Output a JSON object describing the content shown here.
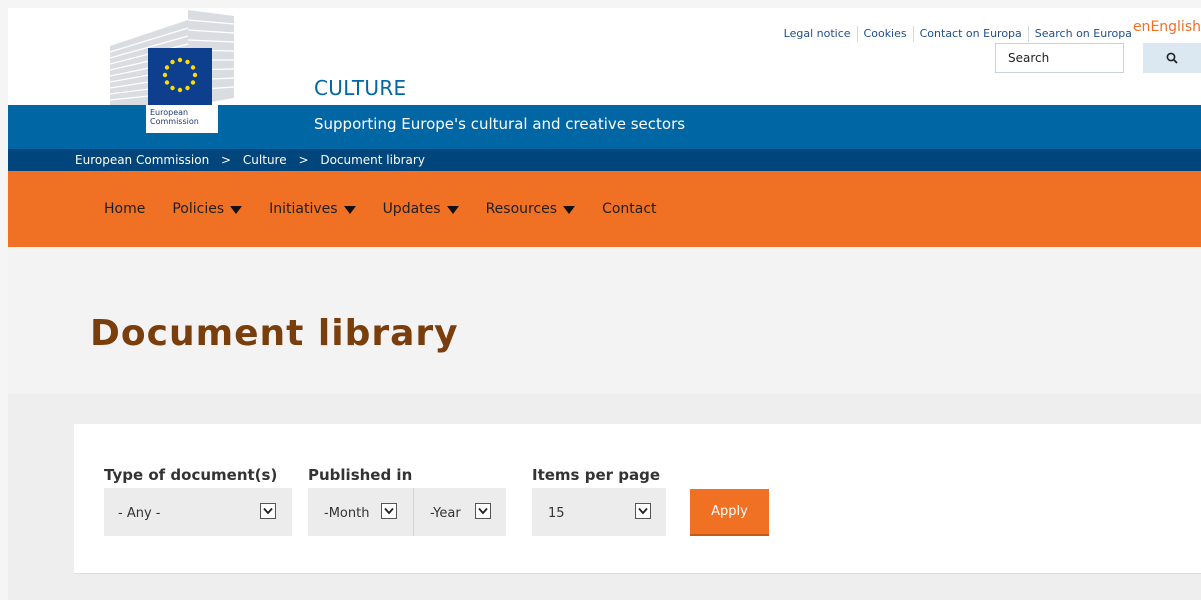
{
  "header": {
    "top_links": [
      "Legal notice",
      "Cookies",
      "Contact on Europa",
      "Search on Europa"
    ],
    "lang_code": "en",
    "lang_label": "English",
    "search_placeholder": "Search",
    "site_title": "CULTURE",
    "tagline": "Supporting Europe's cultural and creative sectors",
    "logo_text_line1": "European",
    "logo_text_line2": "Commission"
  },
  "breadcrumb": [
    "European Commission",
    "Culture",
    "Document library"
  ],
  "breadcrumb_separator": ">",
  "nav": {
    "items": [
      {
        "label": "Home",
        "dropdown": false
      },
      {
        "label": "Policies",
        "dropdown": true
      },
      {
        "label": "Initiatives",
        "dropdown": true
      },
      {
        "label": "Updates",
        "dropdown": true
      },
      {
        "label": "Resources",
        "dropdown": true
      },
      {
        "label": "Contact",
        "dropdown": false
      }
    ]
  },
  "page": {
    "title": "Document library"
  },
  "filters": {
    "type_label": "Type of document(s)",
    "type_value": "- Any -",
    "published_label": "Published in",
    "month_value": "-Month",
    "year_value": "-Year",
    "items_label": "Items per page",
    "items_value": "15",
    "apply_label": "Apply"
  },
  "colors": {
    "brand_orange": "#f07024",
    "brand_blue": "#0066a4",
    "dark_blue": "#00457c",
    "title_brown": "#7a3e0c"
  },
  "icons": {
    "search": "search-icon",
    "caret": "caret-down-icon",
    "dropdown": "chevron-down-icon"
  }
}
